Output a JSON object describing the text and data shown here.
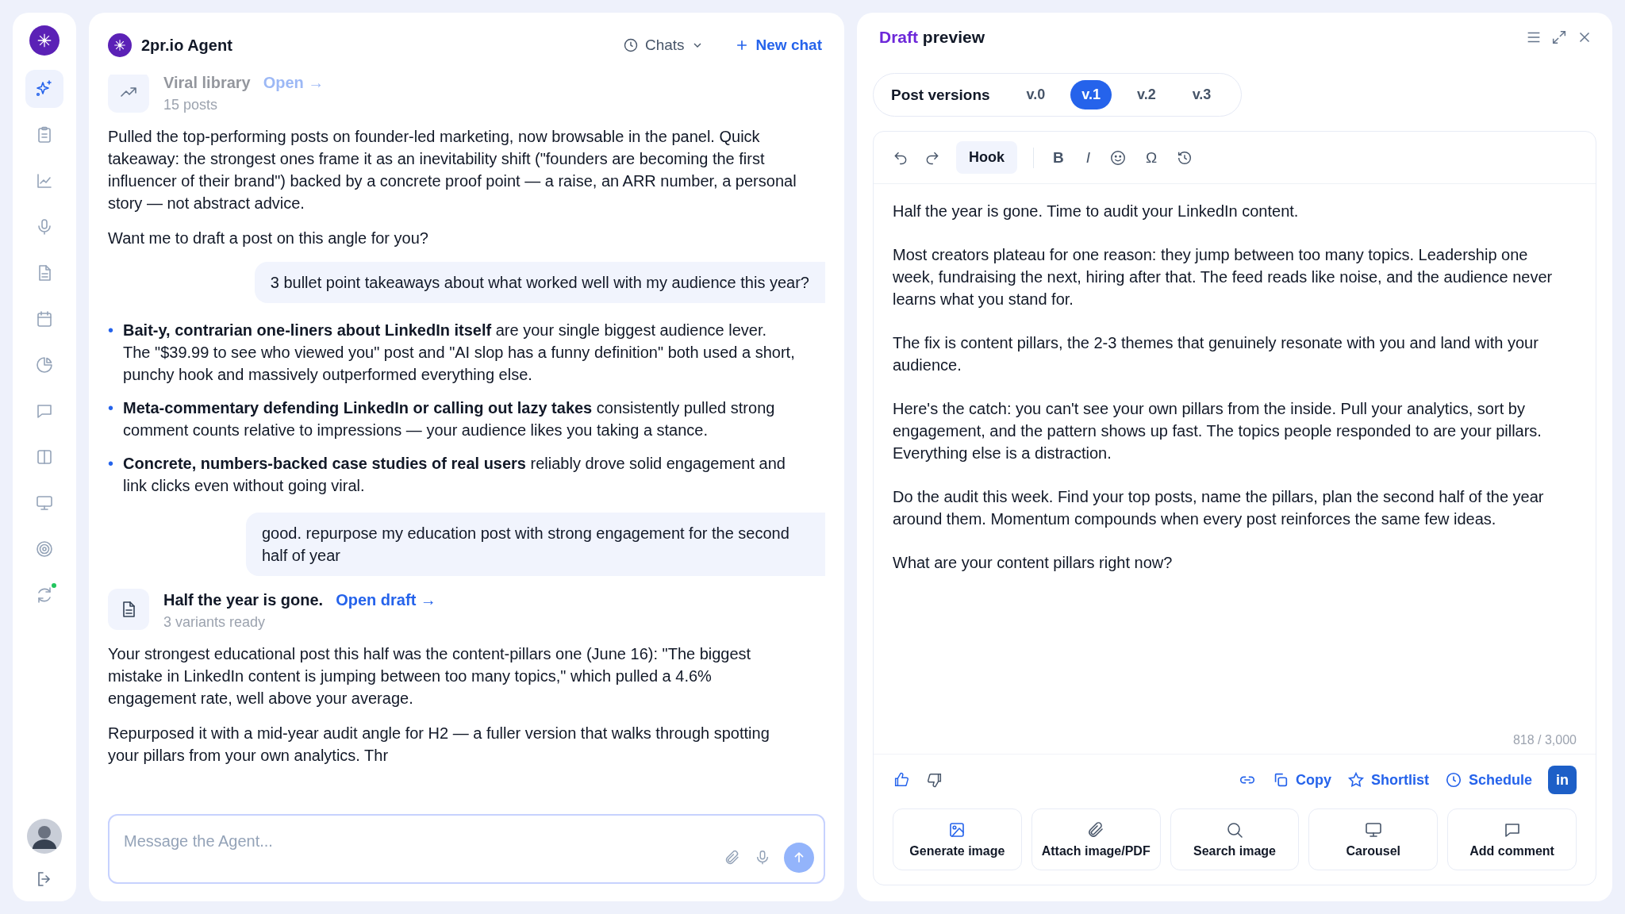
{
  "sidebar": {
    "items": [
      {
        "kind": "sparkle",
        "selected": true,
        "dot": false
      },
      {
        "kind": "clipboard",
        "selected": false,
        "dot": false
      },
      {
        "kind": "chart",
        "selected": false,
        "dot": false
      },
      {
        "kind": "mic",
        "selected": false,
        "dot": false
      },
      {
        "kind": "document",
        "selected": false,
        "dot": false
      },
      {
        "kind": "calendar",
        "selected": false,
        "dot": false
      },
      {
        "kind": "pie",
        "selected": false,
        "dot": false
      },
      {
        "kind": "chat",
        "selected": false,
        "dot": false
      },
      {
        "kind": "columns",
        "selected": false,
        "dot": false
      },
      {
        "kind": "monitor",
        "selected": false,
        "dot": false
      },
      {
        "kind": "target",
        "selected": false,
        "dot": false
      },
      {
        "kind": "refresh",
        "selected": false,
        "dot": true
      }
    ]
  },
  "chat": {
    "title": "2pr.io Agent",
    "chats_button": "Chats",
    "new_chat_button": "New chat",
    "messages": [
      {
        "kind": "library_card",
        "faded": true,
        "title": "Viral library",
        "link": "Open →",
        "subtitle": "15 posts"
      },
      {
        "kind": "agent",
        "paragraphs": [
          "Pulled the top-performing posts on founder-led marketing, now browsable in the panel. Quick takeaway: the strongest ones frame it as an inevitability shift (\"founders are becoming the first influencer of their brand\") backed by a concrete proof point — a raise, an ARR number, a personal story — not abstract advice.",
          "Want me to draft a post on this angle for you?"
        ]
      },
      {
        "kind": "user",
        "text": "3 bullet point takeaways about what worked well with my audience this year?"
      },
      {
        "kind": "bullets",
        "marker": "•",
        "items": [
          "**Bait-y, contrarian one-liners about LinkedIn itself** are your single biggest audience lever. The \"$39.99 to see who viewed you\" post and \"AI slop has a funny definition\" both used a short, punchy hook and massively outperformed everything else.",
          "**Meta-commentary defending LinkedIn or calling out lazy takes** consistently pulled strong comment counts relative to impressions — your audience likes you taking a stance.",
          "**Concrete, numbers-backed case studies of real users** reliably drove solid engagement and link clicks even without going viral."
        ]
      },
      {
        "kind": "user",
        "text": "good. repurpose my education post with strong engagement for the second half of year"
      },
      {
        "kind": "draft_card",
        "faded": false,
        "title": "Half the year is gone.",
        "link": "Open draft →",
        "subtitle": "3 variants ready"
      },
      {
        "kind": "agent",
        "paragraphs": [
          "Your strongest educational post this half was the content-pillars one (June 16): \"The biggest mistake in LinkedIn content is jumping between too many topics,\" which pulled a 4.6% engagement rate, well above your average.",
          "Repurposed it with a mid-year audit angle for H2 — a fuller version that walks through spotting your pillars from your own analytics. Thr"
        ]
      }
    ],
    "input": {
      "placeholder": "Message the Agent..."
    }
  },
  "preview": {
    "title": "**Draft** preview",
    "versions_label": "Post versions",
    "versions": [
      {
        "label": "v.0",
        "selected": false
      },
      {
        "label": "v.1",
        "selected": true
      },
      {
        "label": "v.2",
        "selected": false
      },
      {
        "label": "v.3",
        "selected": false
      }
    ],
    "toolbar": {
      "hook": "Hook",
      "bold": "B",
      "italic": "I",
      "symbol": "Ω"
    },
    "paragraphs": [
      "Half the year is gone. Time to audit your LinkedIn content.",
      "Most creators plateau for one reason: they jump between too many topics. Leadership one week, fundraising the next, hiring after that. The feed reads like noise, and the audience never learns what you stand for.",
      "The fix is content pillars, the 2-3 themes that genuinely resonate with you and land with your audience.",
      "Here's the catch: you can't see your own pillars from the inside. Pull your analytics, sort by engagement, and the pattern shows up fast. The topics people responded to are your pillars. Everything else is a distraction.",
      "Do the audit this week. Find your top posts, name the pillars, plan the second half of the year around them. Momentum compounds when every post reinforces the same few ideas.",
      "What are your content pillars right now?"
    ],
    "counter": "818 / 3,000",
    "actions": {
      "copy": "Copy",
      "shortlist": "Shortlist",
      "schedule": "Schedule",
      "linkedin": "in"
    },
    "tools": [
      {
        "kind": "image",
        "label": "Generate image"
      },
      {
        "kind": "clip",
        "label": "Attach image/PDF"
      },
      {
        "kind": "search",
        "label": "Search image"
      },
      {
        "kind": "monitor",
        "label": "Carousel"
      },
      {
        "kind": "comment",
        "label": "Add comment"
      }
    ]
  }
}
